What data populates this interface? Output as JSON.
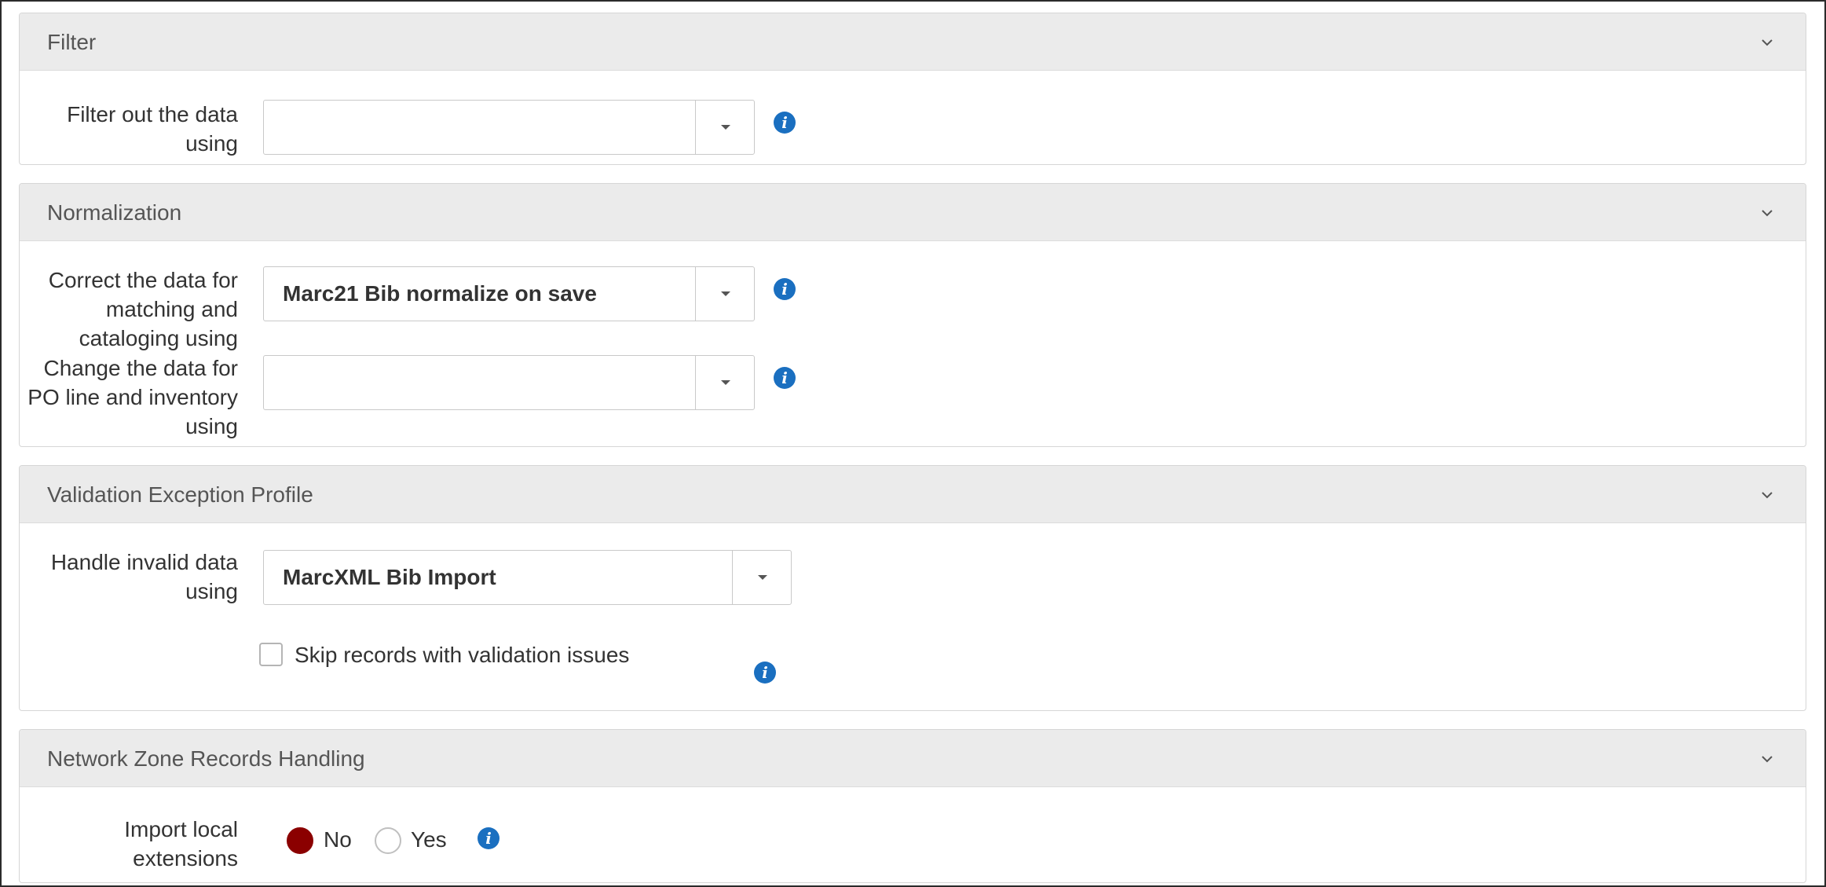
{
  "sections": {
    "filter": {
      "title": "Filter",
      "field_label": "Filter out the data using",
      "select_value": ""
    },
    "normalization": {
      "title": "Normalization",
      "correct_label": "Correct the data for matching and cataloging using",
      "correct_value": "Marc21 Bib normalize on save",
      "change_label": "Change the data for PO line and inventory using",
      "change_value": ""
    },
    "validation": {
      "title": "Validation Exception Profile",
      "handle_label": "Handle invalid data using",
      "handle_value": "MarcXML Bib Import",
      "skip_label": "Skip records with validation issues",
      "skip_checked": false
    },
    "network_zone": {
      "title": "Network Zone Records Handling",
      "import_label": "Import local extensions",
      "option_no": "No",
      "option_yes": "Yes",
      "selected": "No"
    }
  },
  "colors": {
    "info_icon": "#1a6fc0",
    "radio_selected": "#8b0000",
    "header_bg": "#ebebeb"
  },
  "icons": [
    "chevron-down-icon",
    "info-icon",
    "dropdown-caret-icon"
  ]
}
